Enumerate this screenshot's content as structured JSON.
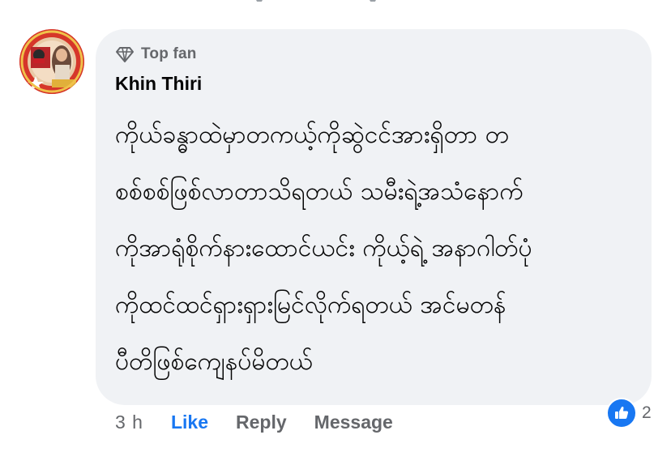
{
  "avatar": {
    "icon": "profile-photo"
  },
  "comment": {
    "badge_icon": "diamond-icon",
    "badge_label": "Top fan",
    "author": "Khin Thiri",
    "lines": [
      "ကိုယ်ခန္ဓာထဲမှာတကယ့်ကိုဆွဲငင်အားရှိတာ တ",
      "စစ်စစ်ဖြစ်လာတာသိရတယ် သမီးရဲ့အသံနောက်",
      "ကိုအာရုံစိုက်နားထောင်ယင်း ကိုယ့်ရဲ့ အနာဂါတ်ပုံ",
      "ကိုထင်ထင်ရှားရှားမြင်လိုက်ရတယ် အင်မတန်",
      "ပီတိဖြစ်ကျေနပ်မိတယ်"
    ]
  },
  "actions": {
    "time": "3 h",
    "like": "Like",
    "reply": "Reply",
    "message": "Message"
  },
  "reactions": {
    "icon": "like-thumb-icon",
    "count": "2"
  },
  "colors": {
    "bubble": "#f0f2f5",
    "accent": "#1877f2",
    "muted": "#65676b",
    "text": "#050505"
  }
}
